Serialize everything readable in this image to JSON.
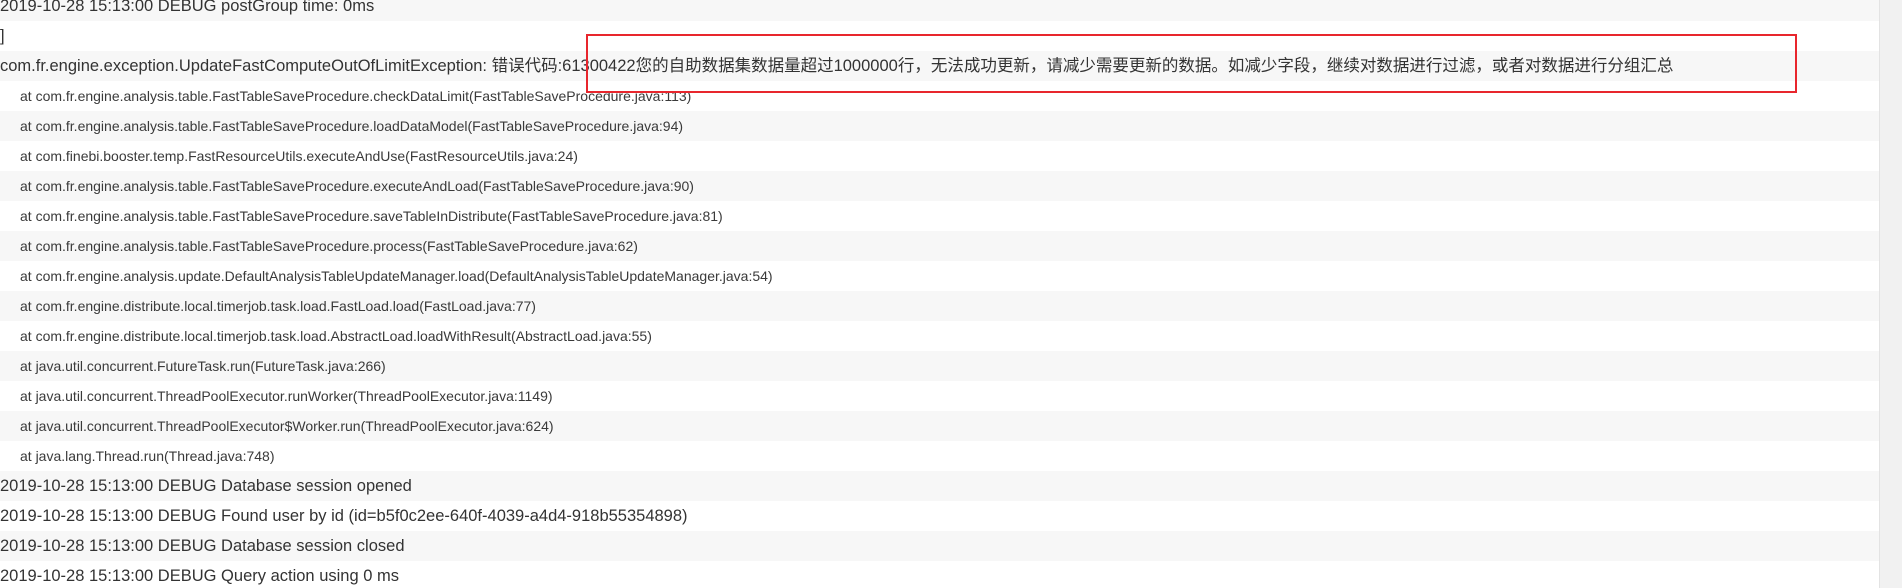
{
  "log": {
    "lines": [
      {
        "kind": "main",
        "text": "2019-10-28 15:13:00  DEBUG  postGroup time: 0ms"
      },
      {
        "kind": "main",
        "text": "]"
      },
      {
        "kind": "main",
        "text": "com.fr.engine.exception.UpdateFastComputeOutOfLimitException: 错误代码:61300422您的自助数据集数据量超过1000000行，无法成功更新，请减少需要更新的数据。如减少字段，继续对数据进行过滤，或者对数据进行分组汇总"
      },
      {
        "kind": "frame",
        "text": "at com.fr.engine.analysis.table.FastTableSaveProcedure.checkDataLimit(FastTableSaveProcedure.java:113)"
      },
      {
        "kind": "frame",
        "text": "at com.fr.engine.analysis.table.FastTableSaveProcedure.loadDataModel(FastTableSaveProcedure.java:94)"
      },
      {
        "kind": "frame",
        "text": "at com.finebi.booster.temp.FastResourceUtils.executeAndUse(FastResourceUtils.java:24)"
      },
      {
        "kind": "frame",
        "text": "at com.fr.engine.analysis.table.FastTableSaveProcedure.executeAndLoad(FastTableSaveProcedure.java:90)"
      },
      {
        "kind": "frame",
        "text": "at com.fr.engine.analysis.table.FastTableSaveProcedure.saveTableInDistribute(FastTableSaveProcedure.java:81)"
      },
      {
        "kind": "frame",
        "text": "at com.fr.engine.analysis.table.FastTableSaveProcedure.process(FastTableSaveProcedure.java:62)"
      },
      {
        "kind": "frame",
        "text": "at com.fr.engine.analysis.update.DefaultAnalysisTableUpdateManager.load(DefaultAnalysisTableUpdateManager.java:54)"
      },
      {
        "kind": "frame",
        "text": "at com.fr.engine.distribute.local.timerjob.task.load.FastLoad.load(FastLoad.java:77)"
      },
      {
        "kind": "frame",
        "text": "at com.fr.engine.distribute.local.timerjob.task.load.AbstractLoad.loadWithResult(AbstractLoad.java:55)"
      },
      {
        "kind": "frame",
        "text": "at java.util.concurrent.FutureTask.run(FutureTask.java:266)"
      },
      {
        "kind": "frame",
        "text": "at java.util.concurrent.ThreadPoolExecutor.runWorker(ThreadPoolExecutor.java:1149)"
      },
      {
        "kind": "frame",
        "text": "at java.util.concurrent.ThreadPoolExecutor$Worker.run(ThreadPoolExecutor.java:624)"
      },
      {
        "kind": "frame",
        "text": "at java.lang.Thread.run(Thread.java:748)"
      },
      {
        "kind": "main",
        "text": "2019-10-28 15:13:00  DEBUG  Database session opened"
      },
      {
        "kind": "main",
        "text": "2019-10-28 15:13:00  DEBUG  Found user by id (id=b5f0c2ee-640f-4039-a4d4-918b55354898)"
      },
      {
        "kind": "main",
        "text": "2019-10-28 15:13:00  DEBUG  Database session closed"
      },
      {
        "kind": "main",
        "text": "2019-10-28 15:13:00  DEBUG  Query action using 0 ms"
      }
    ]
  },
  "colors": {
    "text": "#333333",
    "row_alt": "#f7f7f7",
    "highlight": "#e8262d"
  }
}
